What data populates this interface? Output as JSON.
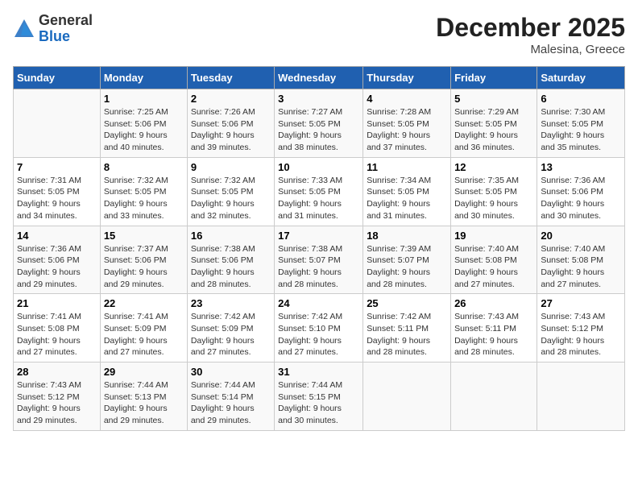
{
  "logo": {
    "general": "General",
    "blue": "Blue"
  },
  "title": "December 2025",
  "subtitle": "Malesina, Greece",
  "days_header": [
    "Sunday",
    "Monday",
    "Tuesday",
    "Wednesday",
    "Thursday",
    "Friday",
    "Saturday"
  ],
  "weeks": [
    [
      {
        "day": "",
        "info": ""
      },
      {
        "day": "1",
        "info": "Sunrise: 7:25 AM\nSunset: 5:06 PM\nDaylight: 9 hours\nand 40 minutes."
      },
      {
        "day": "2",
        "info": "Sunrise: 7:26 AM\nSunset: 5:06 PM\nDaylight: 9 hours\nand 39 minutes."
      },
      {
        "day": "3",
        "info": "Sunrise: 7:27 AM\nSunset: 5:05 PM\nDaylight: 9 hours\nand 38 minutes."
      },
      {
        "day": "4",
        "info": "Sunrise: 7:28 AM\nSunset: 5:05 PM\nDaylight: 9 hours\nand 37 minutes."
      },
      {
        "day": "5",
        "info": "Sunrise: 7:29 AM\nSunset: 5:05 PM\nDaylight: 9 hours\nand 36 minutes."
      },
      {
        "day": "6",
        "info": "Sunrise: 7:30 AM\nSunset: 5:05 PM\nDaylight: 9 hours\nand 35 minutes."
      }
    ],
    [
      {
        "day": "7",
        "info": "Sunrise: 7:31 AM\nSunset: 5:05 PM\nDaylight: 9 hours\nand 34 minutes."
      },
      {
        "day": "8",
        "info": "Sunrise: 7:32 AM\nSunset: 5:05 PM\nDaylight: 9 hours\nand 33 minutes."
      },
      {
        "day": "9",
        "info": "Sunrise: 7:32 AM\nSunset: 5:05 PM\nDaylight: 9 hours\nand 32 minutes."
      },
      {
        "day": "10",
        "info": "Sunrise: 7:33 AM\nSunset: 5:05 PM\nDaylight: 9 hours\nand 31 minutes."
      },
      {
        "day": "11",
        "info": "Sunrise: 7:34 AM\nSunset: 5:05 PM\nDaylight: 9 hours\nand 31 minutes."
      },
      {
        "day": "12",
        "info": "Sunrise: 7:35 AM\nSunset: 5:05 PM\nDaylight: 9 hours\nand 30 minutes."
      },
      {
        "day": "13",
        "info": "Sunrise: 7:36 AM\nSunset: 5:06 PM\nDaylight: 9 hours\nand 30 minutes."
      }
    ],
    [
      {
        "day": "14",
        "info": "Sunrise: 7:36 AM\nSunset: 5:06 PM\nDaylight: 9 hours\nand 29 minutes."
      },
      {
        "day": "15",
        "info": "Sunrise: 7:37 AM\nSunset: 5:06 PM\nDaylight: 9 hours\nand 29 minutes."
      },
      {
        "day": "16",
        "info": "Sunrise: 7:38 AM\nSunset: 5:06 PM\nDaylight: 9 hours\nand 28 minutes."
      },
      {
        "day": "17",
        "info": "Sunrise: 7:38 AM\nSunset: 5:07 PM\nDaylight: 9 hours\nand 28 minutes."
      },
      {
        "day": "18",
        "info": "Sunrise: 7:39 AM\nSunset: 5:07 PM\nDaylight: 9 hours\nand 28 minutes."
      },
      {
        "day": "19",
        "info": "Sunrise: 7:40 AM\nSunset: 5:08 PM\nDaylight: 9 hours\nand 27 minutes."
      },
      {
        "day": "20",
        "info": "Sunrise: 7:40 AM\nSunset: 5:08 PM\nDaylight: 9 hours\nand 27 minutes."
      }
    ],
    [
      {
        "day": "21",
        "info": "Sunrise: 7:41 AM\nSunset: 5:08 PM\nDaylight: 9 hours\nand 27 minutes."
      },
      {
        "day": "22",
        "info": "Sunrise: 7:41 AM\nSunset: 5:09 PM\nDaylight: 9 hours\nand 27 minutes."
      },
      {
        "day": "23",
        "info": "Sunrise: 7:42 AM\nSunset: 5:09 PM\nDaylight: 9 hours\nand 27 minutes."
      },
      {
        "day": "24",
        "info": "Sunrise: 7:42 AM\nSunset: 5:10 PM\nDaylight: 9 hours\nand 27 minutes."
      },
      {
        "day": "25",
        "info": "Sunrise: 7:42 AM\nSunset: 5:11 PM\nDaylight: 9 hours\nand 28 minutes."
      },
      {
        "day": "26",
        "info": "Sunrise: 7:43 AM\nSunset: 5:11 PM\nDaylight: 9 hours\nand 28 minutes."
      },
      {
        "day": "27",
        "info": "Sunrise: 7:43 AM\nSunset: 5:12 PM\nDaylight: 9 hours\nand 28 minutes."
      }
    ],
    [
      {
        "day": "28",
        "info": "Sunrise: 7:43 AM\nSunset: 5:12 PM\nDaylight: 9 hours\nand 29 minutes."
      },
      {
        "day": "29",
        "info": "Sunrise: 7:44 AM\nSunset: 5:13 PM\nDaylight: 9 hours\nand 29 minutes."
      },
      {
        "day": "30",
        "info": "Sunrise: 7:44 AM\nSunset: 5:14 PM\nDaylight: 9 hours\nand 29 minutes."
      },
      {
        "day": "31",
        "info": "Sunrise: 7:44 AM\nSunset: 5:15 PM\nDaylight: 9 hours\nand 30 minutes."
      },
      {
        "day": "",
        "info": ""
      },
      {
        "day": "",
        "info": ""
      },
      {
        "day": "",
        "info": ""
      }
    ]
  ]
}
